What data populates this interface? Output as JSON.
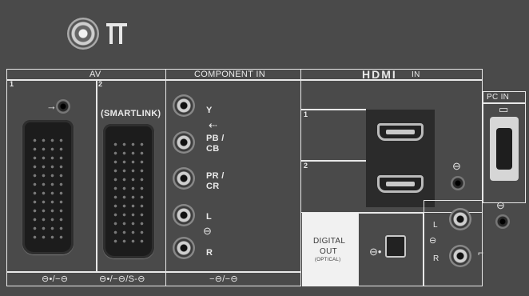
{
  "sections": {
    "av": {
      "title": "AV",
      "slot1": "1",
      "slot2": "2",
      "smartlink": "(SMARTLINK)",
      "footer1": "⊖•/−⊖",
      "footer2": "⊖•/−⊖/S-⊖"
    },
    "component": {
      "title": "COMPONENT IN",
      "y": "Y",
      "pb": "PB /",
      "cb": "CB",
      "pr": "PR /",
      "cr": "CR",
      "l": "L",
      "r": "R",
      "footer": "−⊖/−⊖"
    },
    "hdmi": {
      "logo": "HDMI",
      "suffix": "IN",
      "slot1": "1",
      "slot2": "2"
    },
    "digital": {
      "line1": "DIGITAL",
      "line2": "OUT",
      "line3": "(OPTICAL)"
    },
    "pc": {
      "title": "PC IN"
    }
  },
  "icons": {
    "antenna": "antenna-icon",
    "input_arrow": "arrow-in-icon"
  }
}
